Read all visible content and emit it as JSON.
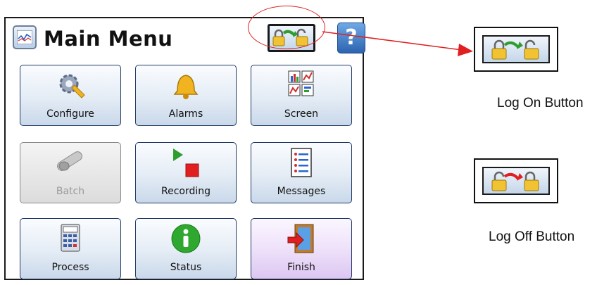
{
  "title": "Main Menu",
  "help_label": "?",
  "buttons": [
    {
      "label": "Configure",
      "icon": "gear-wrench-icon"
    },
    {
      "label": "Alarms",
      "icon": "bell-icon"
    },
    {
      "label": "Screen",
      "icon": "screen-charts-icon"
    },
    {
      "label": "Batch",
      "icon": "batch-icon",
      "disabled": true
    },
    {
      "label": "Recording",
      "icon": "recording-icon"
    },
    {
      "label": "Messages",
      "icon": "messages-list-icon"
    },
    {
      "label": "Process",
      "icon": "calculator-icon"
    },
    {
      "label": "Status",
      "icon": "info-icon"
    },
    {
      "label": "Finish",
      "icon": "exit-door-icon"
    }
  ],
  "callouts": {
    "log_on": "Log On Button",
    "log_off": "Log Off Button"
  },
  "colors": {
    "accent": "#e02020",
    "button_border": "#203a66",
    "finish_bg": "#eddff9"
  }
}
